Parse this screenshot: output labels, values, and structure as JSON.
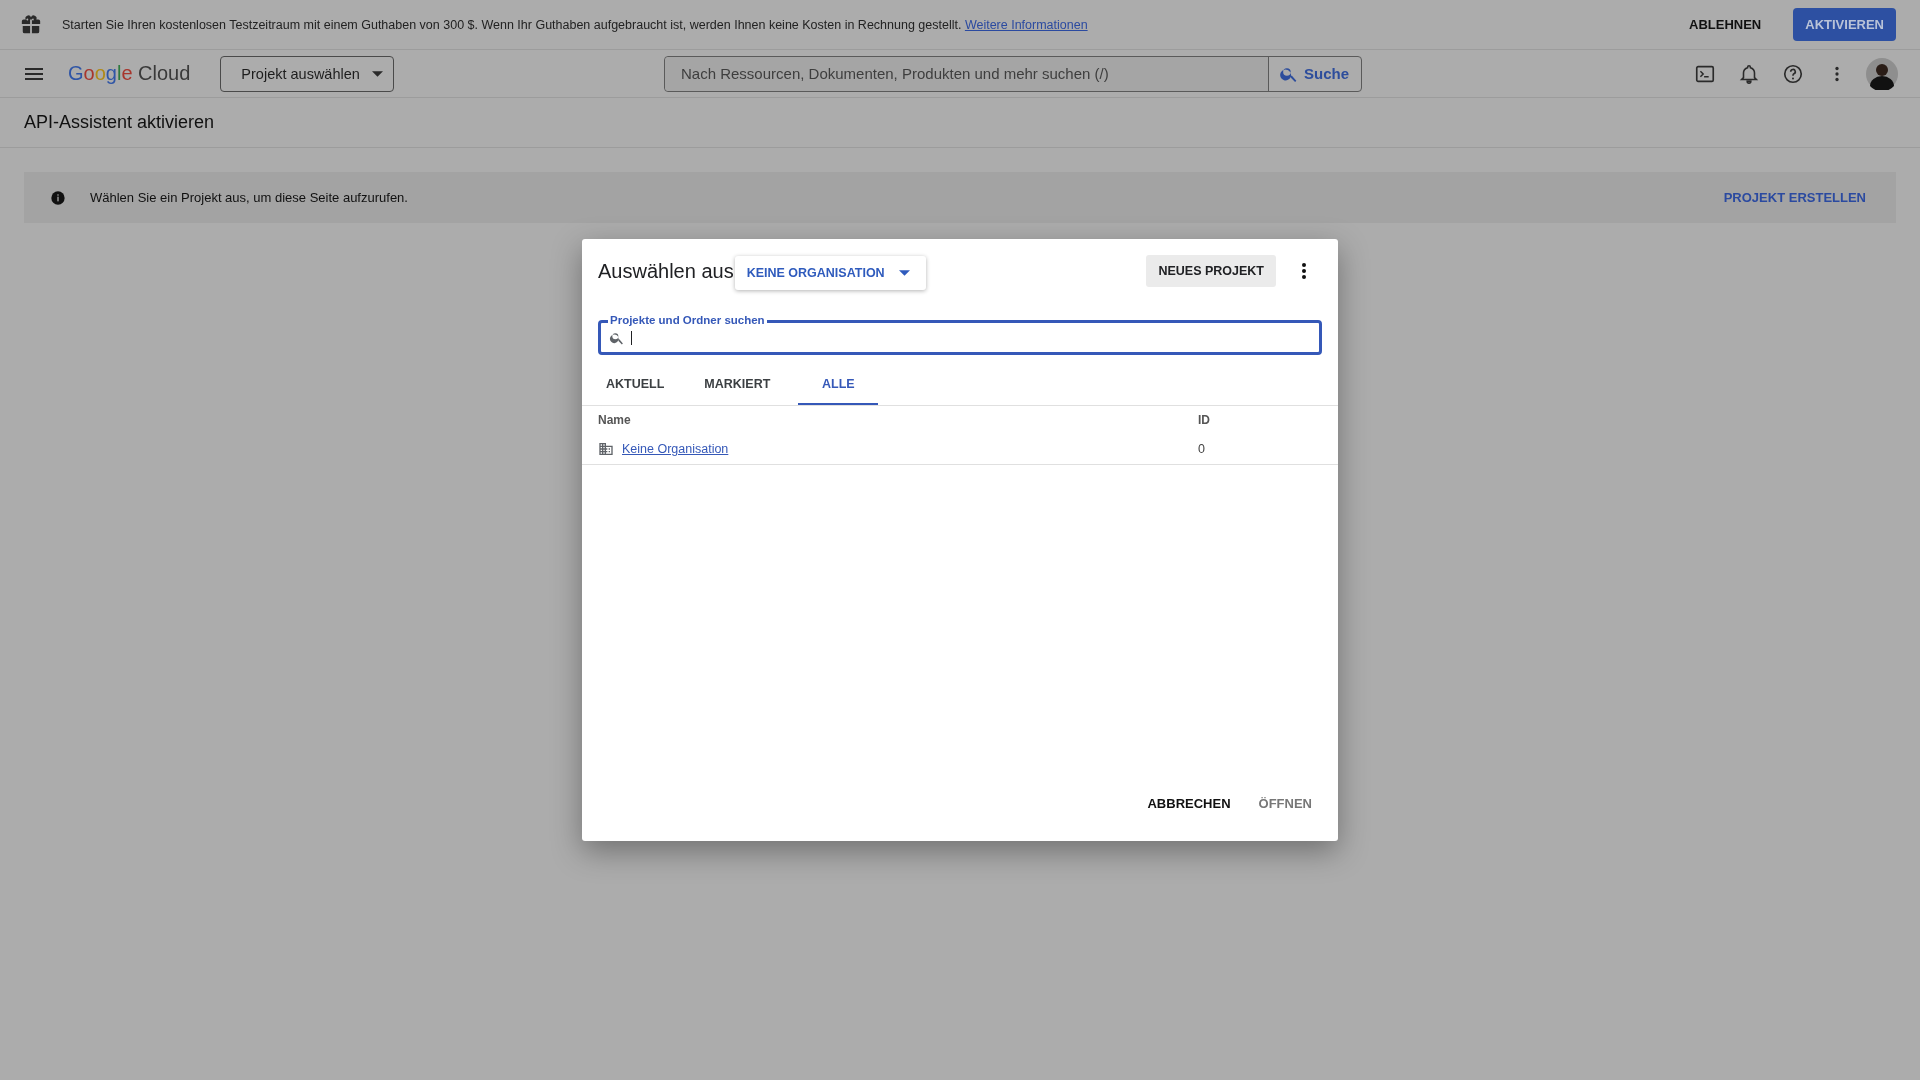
{
  "banner": {
    "text": "Starten Sie Ihren kostenlosen Testzeitraum mit einem Guthaben von 300 $. Wenn Ihr Guthaben aufgebraucht ist, werden Ihnen keine Kosten in Rechnung gestellt.",
    "link": "Weitere Informationen",
    "buttons": [
      {
        "label": "ABLEHNEN",
        "kind": "text"
      },
      {
        "label": "AKTIVIEREN",
        "kind": "primary"
      }
    ]
  },
  "header": {
    "logo": {
      "brand": "Google",
      "product": "Cloud"
    },
    "project_picker": "Projekt auswählen",
    "search": {
      "placeholder": "Nach Ressourcen, Dokumenten, Produkten und mehr suchen (/)",
      "button": "Suche"
    }
  },
  "page_title": "API-Assistent aktivieren",
  "notice": {
    "text": "Wählen Sie ein Projekt aus, um diese Seite aufzurufen.",
    "action": "PROJEKT ERSTELLEN"
  },
  "dialog": {
    "title": "Auswählen aus",
    "org_dropdown": "KEINE ORGANISATION",
    "new_project": "NEUES PROJEKT",
    "search": {
      "label": "Projekte und Ordner suchen",
      "focused": true
    },
    "tabs": [
      {
        "label": "AKTUELL",
        "selected": false
      },
      {
        "label": "MARKIERT",
        "selected": false
      },
      {
        "label": "ALLE",
        "selected": true
      }
    ],
    "table": {
      "columns": [
        "Name",
        "ID"
      ],
      "rows": [
        {
          "name": "Keine Organisation",
          "id": "0"
        }
      ]
    },
    "buttons": [
      {
        "label": "ABBRECHEN",
        "disabled": false
      },
      {
        "label": "ÖFFNEN",
        "disabled": true
      }
    ]
  }
}
